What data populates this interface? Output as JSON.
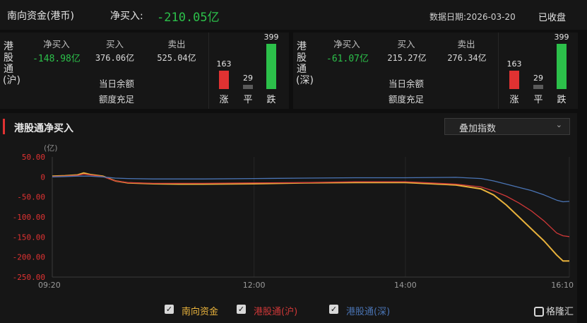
{
  "header": {
    "title": "南向资金(港币)",
    "net_buy_label": "净买入:",
    "net_buy_value": "-210.05亿",
    "date_text": "数据日期:2026-03-20",
    "status": "已收盘"
  },
  "columns": {
    "net_buy": "净买入",
    "buy": "买入",
    "sell": "卖出",
    "quota_label": "当日余额",
    "quota_value": "额度充足"
  },
  "panels": [
    {
      "label": "港股通(沪)",
      "net_buy": "-148.98亿",
      "buy": "376.06亿",
      "sell": "525.04亿",
      "up": 163,
      "flat": 29,
      "down": 399,
      "up_label": "涨",
      "flat_label": "平",
      "down_label": "跌"
    },
    {
      "label": "港股通(深)",
      "net_buy": "-61.07亿",
      "buy": "215.27亿",
      "sell": "276.34亿",
      "up": 163,
      "flat": 29,
      "down": 399,
      "up_label": "涨",
      "flat_label": "平",
      "down_label": "跌"
    }
  ],
  "chart_section": {
    "title": "港股通净买入",
    "dropdown_label": "叠加指数"
  },
  "colors": {
    "up": "#e03232",
    "down": "#2cc04a",
    "flat": "#5a5a5a"
  },
  "chart_data": {
    "type": "line",
    "ylabel": "(亿)",
    "ylim": [
      -250,
      50
    ],
    "yticks": [
      50,
      0,
      -50,
      -100,
      -150,
      -200,
      -250
    ],
    "ytick_labels": [
      "50.00",
      "0",
      "-50.00",
      "-100.00",
      "-150.00",
      "-200.00",
      "-250.00"
    ],
    "xlim_minutes": [
      560,
      970
    ],
    "xticks": [
      "09:20",
      "12:00",
      "14:00",
      "16:10"
    ],
    "xtick_minutes": [
      560,
      720,
      840,
      970
    ],
    "series": [
      {
        "name": "南向资金",
        "color": "#e8b23c",
        "x": [
          560,
          570,
          580,
          585,
          590,
          600,
          610,
          620,
          640,
          660,
          680,
          720,
          760,
          800,
          840,
          880,
          900,
          910,
          920,
          930,
          940,
          950,
          960,
          965,
          970
        ],
        "y": [
          2,
          3,
          5,
          10,
          6,
          2,
          -10,
          -15,
          -17,
          -18,
          -18,
          -17,
          -15,
          -14,
          -14,
          -20,
          -30,
          -45,
          -70,
          -100,
          -130,
          -160,
          -195,
          -210,
          -210
        ]
      },
      {
        "name": "港股通(沪)",
        "color": "#d03838",
        "x": [
          560,
          570,
          580,
          585,
          590,
          600,
          610,
          620,
          640,
          660,
          680,
          720,
          760,
          800,
          840,
          880,
          900,
          910,
          920,
          930,
          940,
          950,
          960,
          965,
          970
        ],
        "y": [
          1,
          2,
          4,
          7,
          5,
          1,
          -10,
          -14,
          -16,
          -16,
          -16,
          -15,
          -14,
          -12,
          -12,
          -18,
          -25,
          -35,
          -48,
          -65,
          -85,
          -110,
          -140,
          -147,
          -149
        ]
      },
      {
        "name": "港股通(深)",
        "color": "#4a74b4",
        "x": [
          560,
          570,
          580,
          590,
          600,
          610,
          620,
          640,
          660,
          680,
          720,
          760,
          800,
          840,
          880,
          900,
          910,
          920,
          930,
          940,
          950,
          960,
          965,
          970
        ],
        "y": [
          0,
          1,
          2,
          2,
          0,
          -3,
          -4,
          -5,
          -5,
          -5,
          -4,
          -3,
          -2,
          -2,
          -1,
          -4,
          -10,
          -18,
          -26,
          -34,
          -45,
          -58,
          -62,
          -61
        ]
      }
    ]
  }
}
